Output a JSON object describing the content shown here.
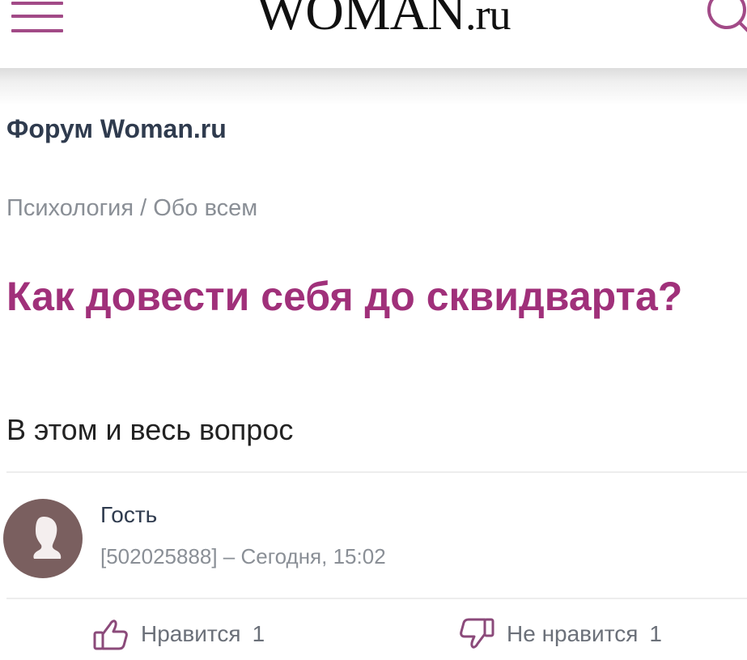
{
  "header": {
    "logo_main": "WOMAN",
    "logo_suffix": ".ru",
    "menu_icon": "hamburger-menu-icon",
    "search_icon": "search-icon",
    "accent_color": "#a24a87"
  },
  "forum": {
    "title": "Форум Woman.ru",
    "breadcrumb": "Психология / Обо всем"
  },
  "question": {
    "title": "Как довести себя до сквидварта?",
    "body": "В этом и весь вопрос",
    "title_color": "#a0307a"
  },
  "author": {
    "name": "Гость",
    "meta": "[502025888] – Сегодня, 15:02",
    "avatar_icon": "user-silhouette-icon"
  },
  "votes": {
    "like_label": "Нравится",
    "like_count": "1",
    "dislike_label": "Не нравится",
    "dislike_count": "1"
  }
}
